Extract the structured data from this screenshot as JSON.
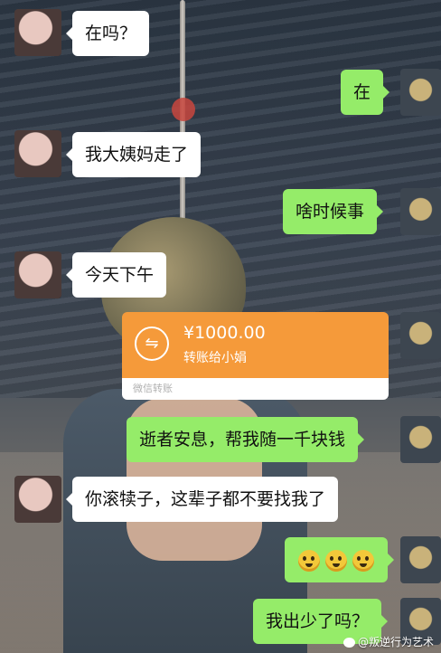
{
  "messages": [
    {
      "side": "left",
      "text": "在吗？"
    },
    {
      "side": "right",
      "text": "在"
    },
    {
      "side": "left",
      "text": "我大姨妈走了"
    },
    {
      "side": "right",
      "text": "啥时候事"
    },
    {
      "side": "left",
      "text": "今天下午"
    },
    {
      "side": "right",
      "type": "transfer"
    },
    {
      "side": "right",
      "text": "逝者安息，帮我随一千块钱"
    },
    {
      "side": "left",
      "text": "你滚犊子，这辈子都不要找我了"
    },
    {
      "side": "right",
      "type": "emoji"
    },
    {
      "side": "right",
      "text": "我出少了吗？"
    }
  ],
  "transfer": {
    "amount": "¥1000.00",
    "description": "转账给小娟",
    "footer": "微信转账",
    "icon": "transfer-arrows-icon",
    "color": "#f59a3a"
  },
  "emoji": {
    "icon": "emoji-face-icon",
    "count": 3
  },
  "watermark": {
    "text": "@叛逆行为艺术",
    "icon": "weibo-icon"
  },
  "colors": {
    "bubble_green": "#95ec69",
    "bubble_white": "#ffffff"
  }
}
